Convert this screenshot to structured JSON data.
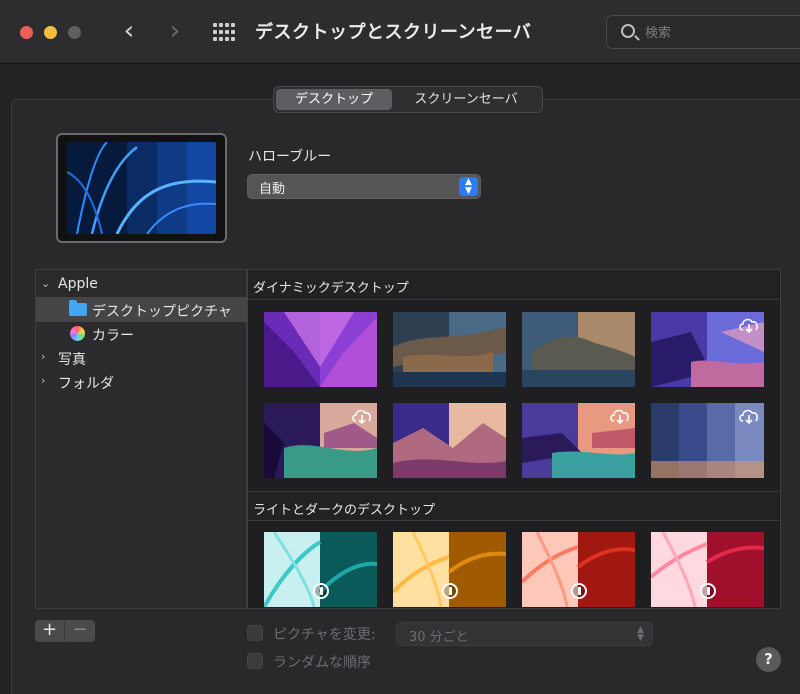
{
  "window": {
    "title": "デスクトップとスクリーンセーバ",
    "search_placeholder": "検索"
  },
  "tabs": [
    {
      "label": "デスクトップ",
      "active": true
    },
    {
      "label": "スクリーンセーバ",
      "active": false
    }
  ],
  "current": {
    "name": "ハローブルー",
    "mode": "自動"
  },
  "sidebar": {
    "items": [
      {
        "label": "Apple",
        "expanded": true
      },
      {
        "label": "デスクトップピクチャ",
        "selected": true
      },
      {
        "label": "カラー"
      },
      {
        "label": "写真",
        "expanded": false
      },
      {
        "label": "フォルダ",
        "expanded": false
      }
    ]
  },
  "gallery": {
    "sections": [
      {
        "title": "ダイナミックデスクトップ"
      },
      {
        "title": "ライトとダークのデスクトップ"
      }
    ]
  },
  "bottom": {
    "add_label": "+",
    "remove_label": "−",
    "change_picture_label": "ピクチャを変更:",
    "interval_value": "30 分ごと",
    "random_order_label": "ランダムな順序",
    "help_label": "?"
  },
  "icons": {
    "back": "chevron-left-icon",
    "forward": "chevron-right-icon",
    "show_all": "grid-icon",
    "search": "search-icon",
    "download": "cloud-download-icon",
    "light_dark": "light-dark-dial-icon"
  },
  "colors": {
    "accent": "#2b7cf0",
    "folder": "#43a6f3",
    "close": "#ec5f57",
    "minimize": "#f5bd3c"
  }
}
